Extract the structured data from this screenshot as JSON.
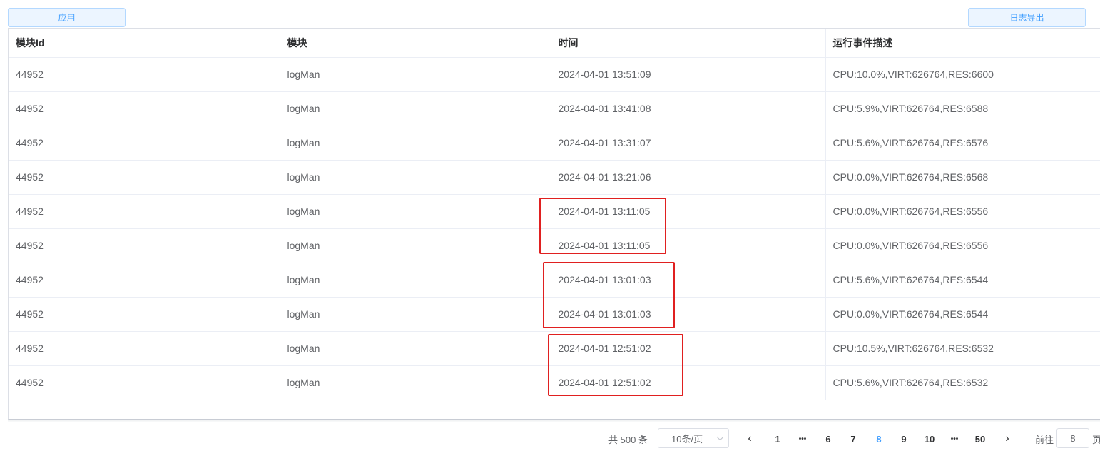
{
  "toolbar": {
    "apply_label": "应用",
    "export_label": "日志导出"
  },
  "table": {
    "columns": [
      "模块Id",
      "模块",
      "时间",
      "运行事件描述"
    ],
    "rows": [
      [
        "44952",
        "logMan",
        "2024-04-01 13:51:09",
        "CPU:10.0%,VIRT:626764,RES:6600"
      ],
      [
        "44952",
        "logMan",
        "2024-04-01 13:41:08",
        "CPU:5.9%,VIRT:626764,RES:6588"
      ],
      [
        "44952",
        "logMan",
        "2024-04-01 13:31:07",
        "CPU:5.6%,VIRT:626764,RES:6576"
      ],
      [
        "44952",
        "logMan",
        "2024-04-01 13:21:06",
        "CPU:0.0%,VIRT:626764,RES:6568"
      ],
      [
        "44952",
        "logMan",
        "2024-04-01 13:11:05",
        "CPU:0.0%,VIRT:626764,RES:6556"
      ],
      [
        "44952",
        "logMan",
        "2024-04-01 13:11:05",
        "CPU:0.0%,VIRT:626764,RES:6556"
      ],
      [
        "44952",
        "logMan",
        "2024-04-01 13:01:03",
        "CPU:5.6%,VIRT:626764,RES:6544"
      ],
      [
        "44952",
        "logMan",
        "2024-04-01 13:01:03",
        "CPU:0.0%,VIRT:626764,RES:6544"
      ],
      [
        "44952",
        "logMan",
        "2024-04-01 12:51:02",
        "CPU:10.5%,VIRT:626764,RES:6532"
      ],
      [
        "44952",
        "logMan",
        "2024-04-01 12:51:02",
        "CPU:5.6%,VIRT:626764,RES:6532"
      ]
    ]
  },
  "pagination": {
    "total_label": "共 500 条",
    "page_size": "10条/页",
    "prev_glyph": "‹",
    "next_glyph": "›",
    "pages": [
      "1",
      "•••",
      "6",
      "7",
      "8",
      "9",
      "10",
      "•••",
      "50"
    ],
    "current": "8",
    "goto_label": "前往",
    "goto_value": "8",
    "goto_suffix": "页"
  },
  "colors": {
    "accent": "#409eff",
    "highlight_box": "#e02020"
  }
}
